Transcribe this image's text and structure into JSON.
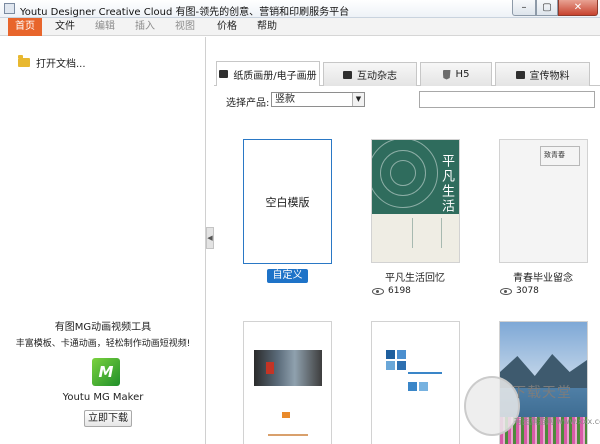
{
  "window": {
    "title": "Youtu Designer Creative Cloud 有图-领先的创意、营销和印刷服务平台",
    "minimize_glyph": "–",
    "maximize_glyph": "▢",
    "close_glyph": "✕"
  },
  "menu": {
    "items": [
      {
        "label": "首页",
        "state": "active"
      },
      {
        "label": "文件",
        "state": "normal"
      },
      {
        "label": "编辑",
        "state": "disabled"
      },
      {
        "label": "插入",
        "state": "disabled"
      },
      {
        "label": "视图",
        "state": "disabled"
      },
      {
        "label": "价格",
        "state": "normal"
      },
      {
        "label": "帮助",
        "state": "normal"
      }
    ]
  },
  "sidebar": {
    "open_doc": "打开文档...",
    "promo": {
      "title": "有图MG动画视频工具",
      "desc": "丰富模板、卡通动画，轻松制作动画短视频!",
      "logo_text": "M",
      "product_name": "Youtu MG Maker",
      "download_label": "立即下载"
    }
  },
  "tabs": [
    {
      "label": "纸质画册/电子画册",
      "icon": "book-icon",
      "active": true
    },
    {
      "label": "互动杂志",
      "icon": "book-icon",
      "active": false
    },
    {
      "label": "H5",
      "icon": "html5-icon",
      "active": false
    },
    {
      "label": "宣传物料",
      "icon": "clipboard-icon",
      "active": false
    }
  ],
  "filter": {
    "label": "选择产品:",
    "selected": "竖款"
  },
  "templates": {
    "blank": {
      "label": "空白模版",
      "action": "自定义"
    },
    "items": [
      {
        "name": "平凡生活回忆",
        "views": "6198",
        "cover_text": "平凡生活"
      },
      {
        "name": "青春毕业留念",
        "views": "3078",
        "cover_text": "致青春"
      }
    ]
  },
  "watermark": {
    "line1": "下载天堂",
    "line2": "有图旗游网 www.xxx.com"
  },
  "colors": {
    "accent": "#e8652b",
    "primary": "#1e73c8",
    "cover_green": "#2f6c5d"
  }
}
